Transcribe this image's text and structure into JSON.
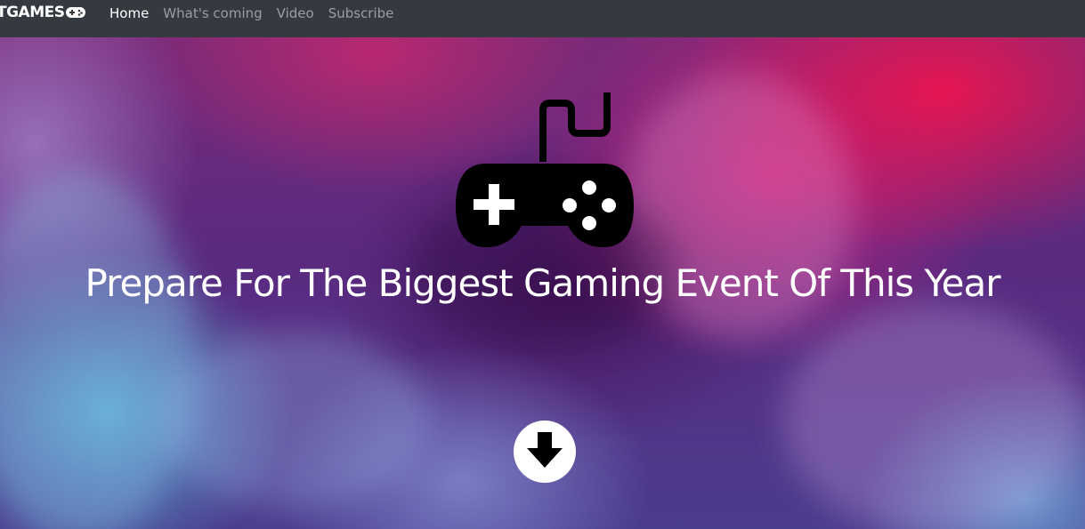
{
  "navbar": {
    "brand": "TGAMES",
    "brand_icon": "gamepad-icon",
    "links": [
      {
        "label": "Home",
        "active": true
      },
      {
        "label": "What's coming",
        "active": false
      },
      {
        "label": "Video",
        "active": false
      },
      {
        "label": "Subscribe",
        "active": false
      }
    ]
  },
  "hero": {
    "icon": "gamepad-icon",
    "headline": "Prepare For The Biggest Gaming Event Of This Year",
    "scroll_icon": "arrow-down-circle-icon"
  },
  "colors": {
    "navbar_bg": "#343a40",
    "nav_text": "#ffffff",
    "nav_text_muted": "rgba(255,255,255,0.5)",
    "accent_pink": "#ec1450",
    "accent_blue": "#5ac8e6"
  }
}
